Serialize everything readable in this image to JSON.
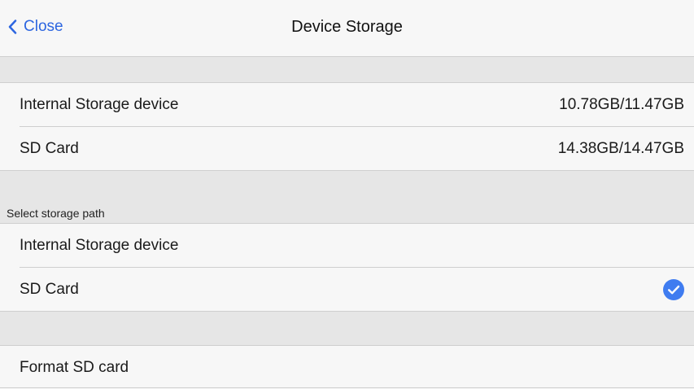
{
  "nav": {
    "back_label": "Close",
    "title": "Device Storage"
  },
  "storage": {
    "items": [
      {
        "label": "Internal Storage device",
        "value": "10.78GB/11.47GB"
      },
      {
        "label": "SD Card",
        "value": "14.38GB/14.47GB"
      }
    ]
  },
  "path": {
    "header": "Select storage path",
    "options": [
      {
        "label": "Internal Storage device",
        "selected": false
      },
      {
        "label": "SD Card",
        "selected": true
      }
    ]
  },
  "format": {
    "label": "Format SD card"
  },
  "colors": {
    "accent": "#2d66e0",
    "check": "#3f7cf0",
    "background": "#f7f7f7",
    "section_background": "#e6e6e6"
  },
  "icons": {
    "back": "chevron-left-icon",
    "selected": "checkmark-circle-icon"
  }
}
